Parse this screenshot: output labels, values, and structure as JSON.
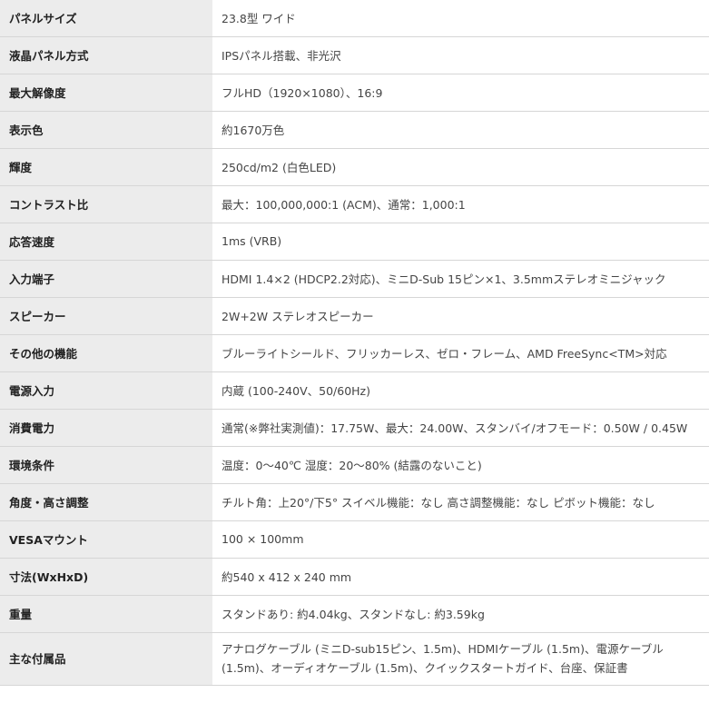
{
  "rows": [
    {
      "label": "パネルサイズ",
      "value": "23.8型 ワイド"
    },
    {
      "label": "液晶パネル方式",
      "value": "IPSパネル搭載、非光沢"
    },
    {
      "label": "最大解像度",
      "value": "フルHD（1920×1080）、16:9"
    },
    {
      "label": "表示色",
      "value": "約1670万色"
    },
    {
      "label": "輝度",
      "value": "250cd/m2 (白色LED)"
    },
    {
      "label": "コントラスト比",
      "value": "最大：100,000,000:1 (ACM)、通常：1,000:1"
    },
    {
      "label": "応答速度",
      "value": "1ms (VRB)"
    },
    {
      "label": "入力端子",
      "value": "HDMI 1.4×2 (HDCP2.2対応)、ミニD-Sub 15ピン×1、3.5mmステレオミニジャック"
    },
    {
      "label": "スピーカー",
      "value": "2W+2W ステレオスピーカー"
    },
    {
      "label": "その他の機能",
      "value": "ブルーライトシールド、フリッカーレス、ゼロ・フレーム、AMD FreeSync<TM>対応"
    },
    {
      "label": "電源入力",
      "value": "内蔵 (100-240V、50/60Hz)"
    },
    {
      "label": "消費電力",
      "value": "通常(※弊社実測値)：17.75W、最大：24.00W、スタンバイ/オフモード：0.50W / 0.45W"
    },
    {
      "label": "環境条件",
      "value": "温度：0～40℃ 湿度：20～80% (結露のないこと)"
    },
    {
      "label": "角度・高さ調整",
      "value": "チルト角：上20°/下5° スイベル機能：なし 高さ調整機能：なし ピボット機能：なし"
    },
    {
      "label": "VESAマウント",
      "value": "100 × 100mm"
    },
    {
      "label": "寸法(WxHxD)",
      "value": "約540 x 412 x 240 mm"
    },
    {
      "label": "重量",
      "value": "スタンドあり: 約4.04kg、スタンドなし: 約3.59kg"
    },
    {
      "label": "主な付属品",
      "value_line1": "アナログケーブル (ミニD-sub15ピン、1.5m)、HDMIケーブル (1.5m)、電源ケーブル",
      "value_line2": "(1.5m)、オーディオケーブル (1.5m)、クイックスタートガイド、台座、保証書"
    }
  ]
}
